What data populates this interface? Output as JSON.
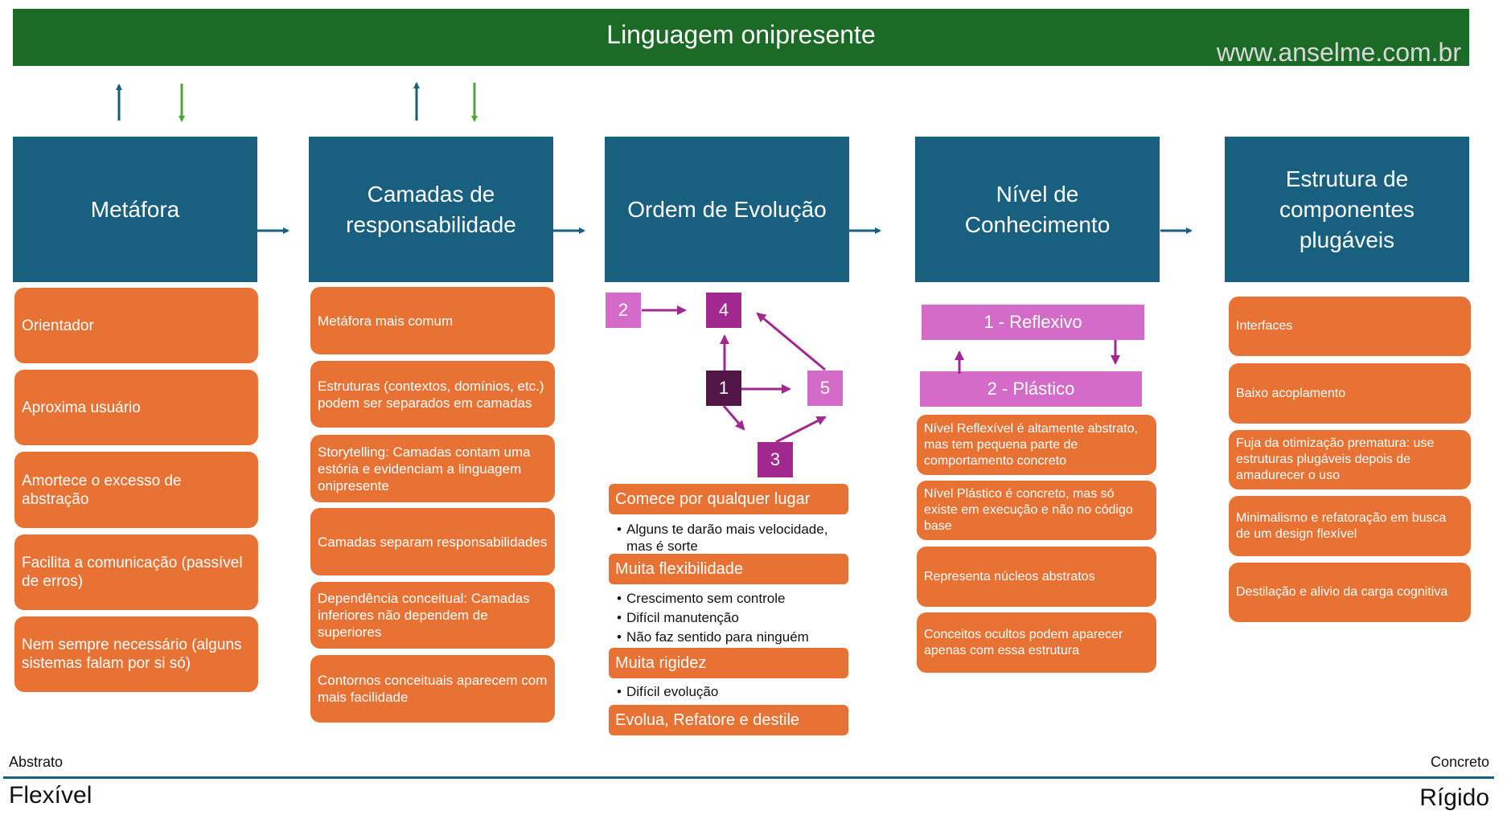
{
  "banner": {
    "title": "Linguagem onipresente",
    "url": "www.anselme.com.br"
  },
  "colors": {
    "banner_green": "#1b6b27",
    "header_blue": "#185f80",
    "card_orange": "#e87234",
    "level_pink": "#d46bc8",
    "node_purple": "#a0288f",
    "node_dark_purple": "#521547",
    "arrow_blue": "#185f80",
    "arrow_green": "#4ea53a",
    "arrow_purple": "#a0288f"
  },
  "columns": [
    {
      "title": "Metáfora",
      "cards": [
        "Orientador",
        "Aproxima usuário",
        "Amortece o excesso de abstração",
        "Facilita a comunicação (passível de erros)",
        "Nem sempre necessário (alguns sistemas falam por si só)"
      ]
    },
    {
      "title": "Camadas de responsabilidade",
      "cards": [
        "Metáfora mais comum",
        "Estruturas (contextos, domínios, etc.) podem ser separados em camadas",
        "Storytelling: Camadas contam uma estória e evidenciam a linguagem onipresente",
        "Camadas separam responsabilidades",
        "Dependência conceitual: Camadas inferiores não dependem de superiores",
        "Contornos conceituais aparecem com mais facilidade"
      ]
    },
    {
      "title": "Ordem de Evolução",
      "nodes": [
        "1",
        "2",
        "3",
        "4",
        "5"
      ],
      "sections": [
        {
          "heading": "Comece por qualquer lugar",
          "bullets": [
            "Alguns te darão mais velocidade, mas é sorte"
          ]
        },
        {
          "heading": "Muita flexibilidade",
          "bullets": [
            "Crescimento sem controle",
            "Difícil manutenção",
            "Não faz sentido para ninguém"
          ]
        },
        {
          "heading": "Muita rigidez",
          "bullets": [
            "Difícil evolução"
          ]
        },
        {
          "heading": "Evolua, Refatore e destile",
          "bullets": []
        }
      ]
    },
    {
      "title": "Nível de Conhecimento",
      "levels": [
        "1 - Reflexivo",
        "2 - Plástico"
      ],
      "cards": [
        "Nível Reflexível é altamente abstrato, mas tem pequena parte de comportamento concreto",
        "Nível Plástico é concreto, mas só existe em execução e não no código base",
        "Representa núcleos abstratos",
        "Conceitos ocultos podem aparecer apenas com essa estrutura"
      ]
    },
    {
      "title": "Estrutura de componentes plugáveis",
      "cards": [
        "Interfaces",
        "Baixo acoplamento",
        "Fuja da otimização prematura: use estruturas plugáveis depois de amadurecer o uso",
        "Minimalismo e refatoração em busca de um design flexível",
        "Destilação e alivio da carga cognitiva"
      ]
    }
  ],
  "axis": {
    "left_small": "Abstrato",
    "right_small": "Concreto",
    "left_big": "Flexível",
    "right_big": "Rígido"
  }
}
